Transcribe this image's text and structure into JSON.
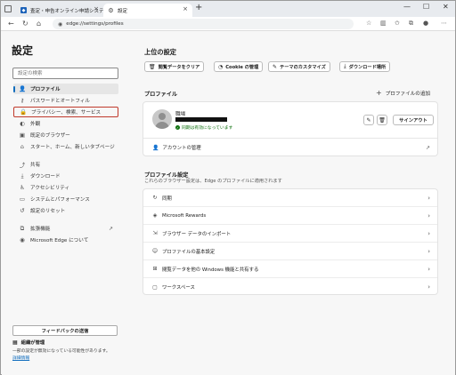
{
  "tabs": [
    {
      "title": "査定・申告オンライン申請システム"
    },
    {
      "title": "設定"
    }
  ],
  "window_controls": {
    "minimize": "—",
    "maximize": "☐",
    "close": "✕"
  },
  "address": {
    "url": "edge://settings/profiles",
    "scheme_label": "Edge"
  },
  "sidebar": {
    "title": "設定",
    "search_placeholder": "設定の検索",
    "items": [
      {
        "label": "プロファイル",
        "icon": "person-icon"
      },
      {
        "label": "パスワードとオートフィル",
        "icon": "key-icon"
      },
      {
        "label": "プライバシー、検索、サービス",
        "icon": "lock-icon"
      },
      {
        "label": "外観",
        "icon": "palette-icon"
      },
      {
        "label": "既定のブラウザー",
        "icon": "browser-icon"
      },
      {
        "label": "スタート、ホーム、新しいタブページ",
        "icon": "home-icon"
      },
      {
        "label": "共有",
        "icon": "share-icon"
      },
      {
        "label": "ダウンロード",
        "icon": "download-icon"
      },
      {
        "label": "アクセシビリティ",
        "icon": "accessibility-icon"
      },
      {
        "label": "システムとパフォーマンス",
        "icon": "system-icon"
      },
      {
        "label": "設定のリセット",
        "icon": "reset-icon"
      },
      {
        "label": "拡張機能",
        "icon": "extension-icon"
      },
      {
        "label": "Microsoft Edge について",
        "icon": "edge-icon"
      }
    ],
    "feedback_label": "フィードバックの送信",
    "managed_label": "組織が管理",
    "managed_desc": "一部の設定が無効になっている可能性があります。",
    "managed_link": "詳細情報"
  },
  "main": {
    "top_settings_title": "上位の設定",
    "quick_buttons": [
      {
        "label": "閲覧データをクリア",
        "icon": "trash-icon"
      },
      {
        "label": "Cookie の管理",
        "icon": "cookie-icon"
      },
      {
        "label": "テーマのカスタマイズ",
        "icon": "brush-icon"
      },
      {
        "label": "ダウンロード場所",
        "icon": "download-icon"
      }
    ],
    "profile_title": "プロファイル",
    "add_profile": "プロファイルの追加",
    "profile": {
      "name": "職場",
      "sync_status": "同期は有効になっています",
      "sign_out": "サインアウト",
      "manage_account": "アカウントの管理"
    },
    "profile_settings_title": "プロファイル設定",
    "profile_settings_desc": "これらのブラウザー設定は、Edge のプロファイルに適用されます",
    "profile_settings": [
      {
        "label": "同期",
        "icon": "sync-icon"
      },
      {
        "label": "Microsoft Rewards",
        "icon": "rewards-icon"
      },
      {
        "label": "ブラウザー データのインポート",
        "icon": "import-icon"
      },
      {
        "label": "プロファイルの基本設定",
        "icon": "profile-settings-icon"
      },
      {
        "label": "閲覧データを他の Windows 機能と共有する",
        "icon": "windows-icon"
      },
      {
        "label": "ワークスペース",
        "icon": "workspace-icon"
      }
    ]
  },
  "colors": {
    "accent": "#0f6cbd",
    "highlight_box": "#c0392b",
    "sync_green": "#0e700e"
  }
}
